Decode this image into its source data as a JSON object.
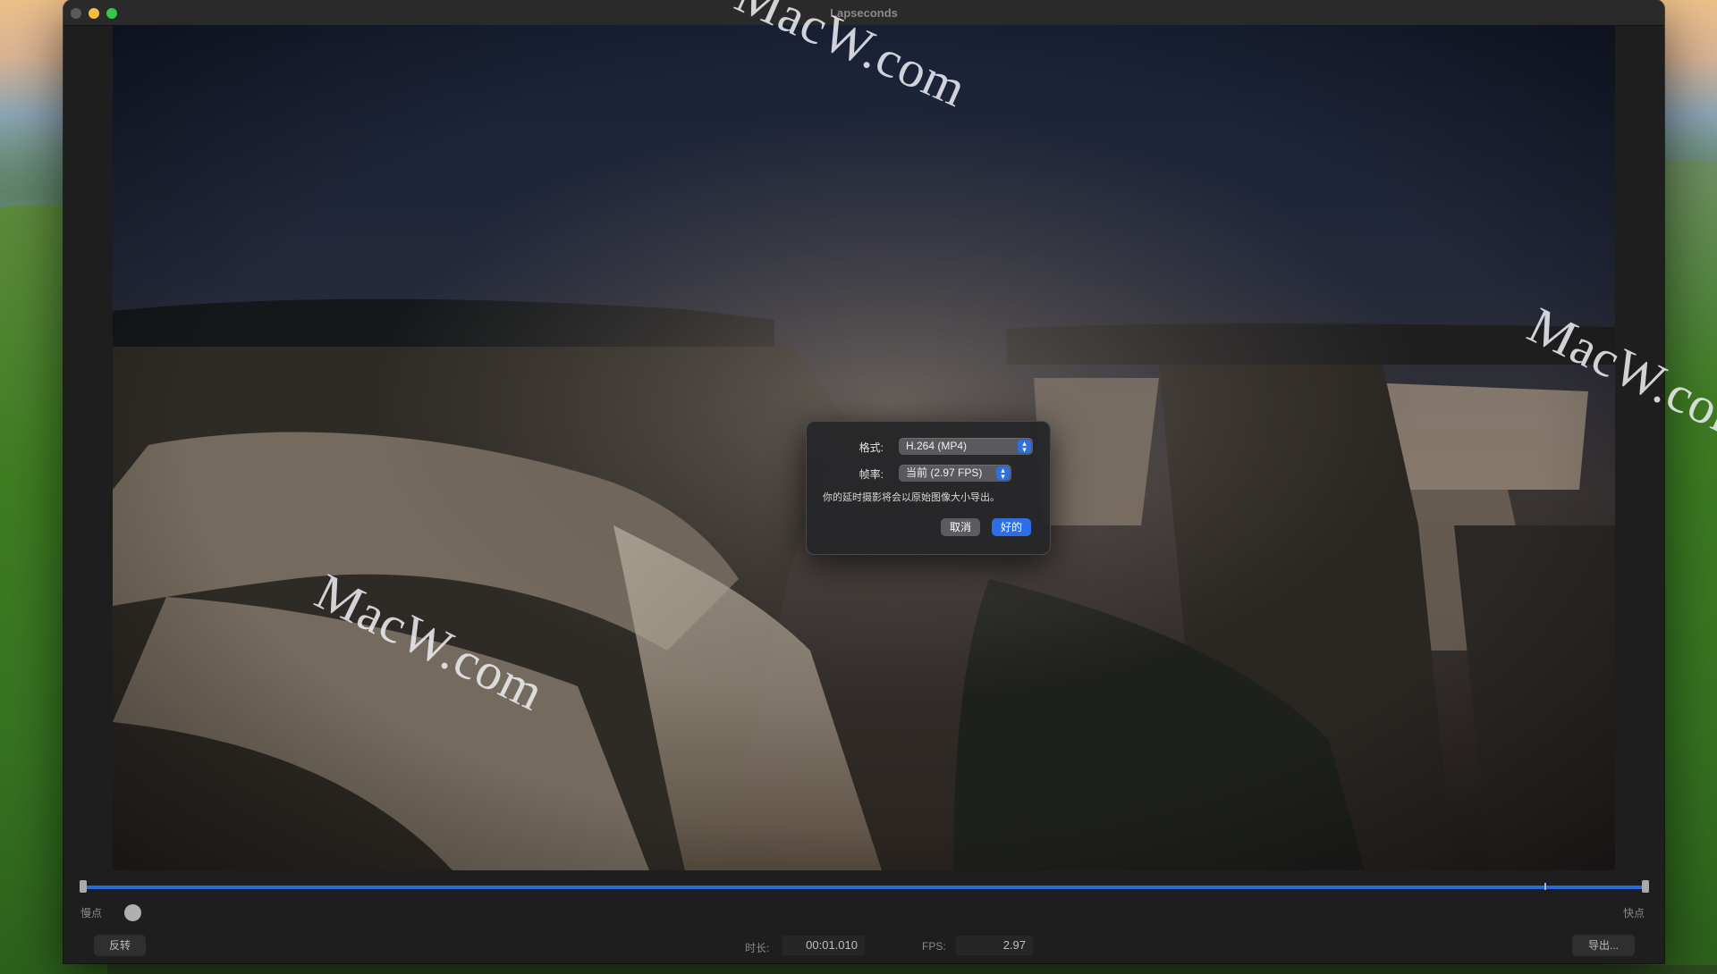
{
  "window": {
    "title": "Lapseconds"
  },
  "dialog": {
    "format_label": "格式:",
    "format_value": "H.264 (MP4)",
    "framerate_label": "帧率:",
    "framerate_value": "当前 (2.97 FPS)",
    "message": "你的延时摄影将会以原始图像大小导出。",
    "cancel_label": "取消",
    "ok_label": "好的"
  },
  "controls": {
    "slow_label": "慢点",
    "fast_label": "快点",
    "reverse_label": "反转",
    "duration_label": "时长:",
    "duration_value": "00:01.010",
    "fps_label": "FPS:",
    "fps_value": "2.97",
    "export_label": "导出..."
  },
  "watermark": {
    "text": "MacW.com"
  },
  "colors": {
    "accent": "#2d6ee6",
    "track": "#2a6bd8",
    "window_bg": "#1e1e1e"
  }
}
